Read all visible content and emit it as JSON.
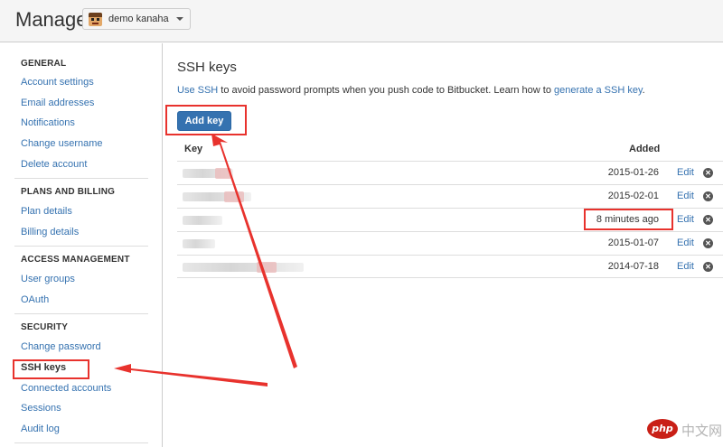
{
  "header": {
    "title": "Manage",
    "account": {
      "name": "demo kanaha",
      "avatar_icon": "cartoon-face-avatar"
    }
  },
  "sidebar": {
    "sections": [
      {
        "heading": "GENERAL",
        "items": [
          "Account settings",
          "Email addresses",
          "Notifications",
          "Change username",
          "Delete account"
        ]
      },
      {
        "heading": "PLANS AND BILLING",
        "items": [
          "Plan details",
          "Billing details"
        ]
      },
      {
        "heading": "ACCESS MANAGEMENT",
        "items": [
          "User groups",
          "OAuth"
        ]
      },
      {
        "heading": "SECURITY",
        "items": [
          "Change password",
          "SSH keys",
          "Connected accounts",
          "Sessions",
          "Audit log"
        ]
      }
    ],
    "active_item": "SSH keys"
  },
  "main": {
    "title": "SSH keys",
    "intro": {
      "link1": "Use SSH",
      "text1": " to avoid password prompts when you push code to Bitbucket. Learn how to ",
      "link2": "generate a SSH key",
      "text2": "."
    },
    "add_key_label": "Add key",
    "table": {
      "headers": {
        "key": "Key",
        "added": "Added"
      },
      "rows": [
        {
          "added": "2015-01-26",
          "edit": "Edit"
        },
        {
          "added": "2015-02-01",
          "edit": "Edit"
        },
        {
          "added": "8 minutes ago",
          "edit": "Edit"
        },
        {
          "added": "2015-01-07",
          "edit": "Edit"
        },
        {
          "added": "2014-07-18",
          "edit": "Edit"
        }
      ]
    }
  },
  "annotations": {
    "color": "#e8322d"
  },
  "watermark": {
    "logo": "php",
    "text": "中文网"
  },
  "colors": {
    "link": "#3572b0",
    "primary_button": "#3572b0",
    "header_bg": "#f5f5f5"
  }
}
